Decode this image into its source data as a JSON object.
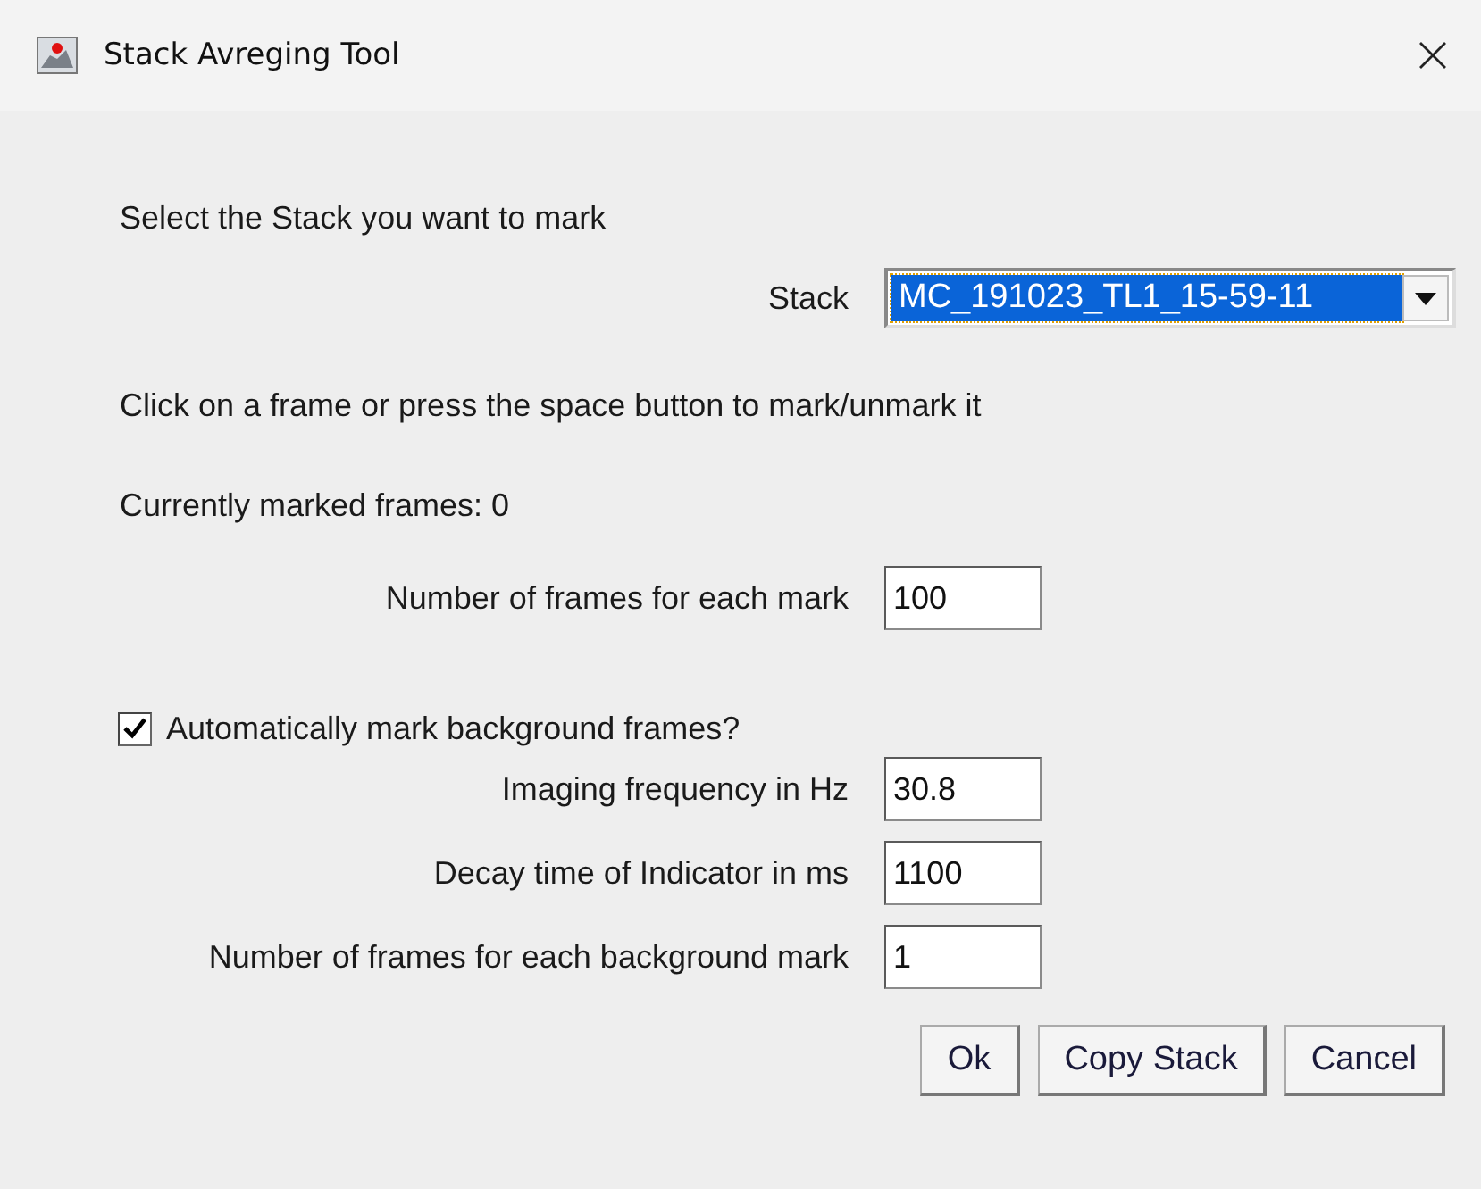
{
  "window": {
    "title": "Stack Avreging Tool"
  },
  "intro": "Select the Stack you want to mark",
  "stack": {
    "label": "Stack",
    "value": "MC_191023_TL1_15-59-11"
  },
  "instruction": "Click on a frame or press the space button to mark/unmark it",
  "marked_count": "Currently marked frames: 0",
  "frames_per_mark": {
    "label": "Number of frames for each mark",
    "value": "100"
  },
  "auto_background": {
    "label": "Automatically mark background frames?",
    "checked": true
  },
  "background_fields": [
    {
      "label": "Imaging frequency in Hz",
      "value": "30.8"
    },
    {
      "label": "Decay time of Indicator in ms",
      "value": "1100"
    },
    {
      "label": "Number of frames for each background mark",
      "value": "1"
    }
  ],
  "buttons": [
    "Ok",
    "Copy Stack",
    "Cancel"
  ]
}
